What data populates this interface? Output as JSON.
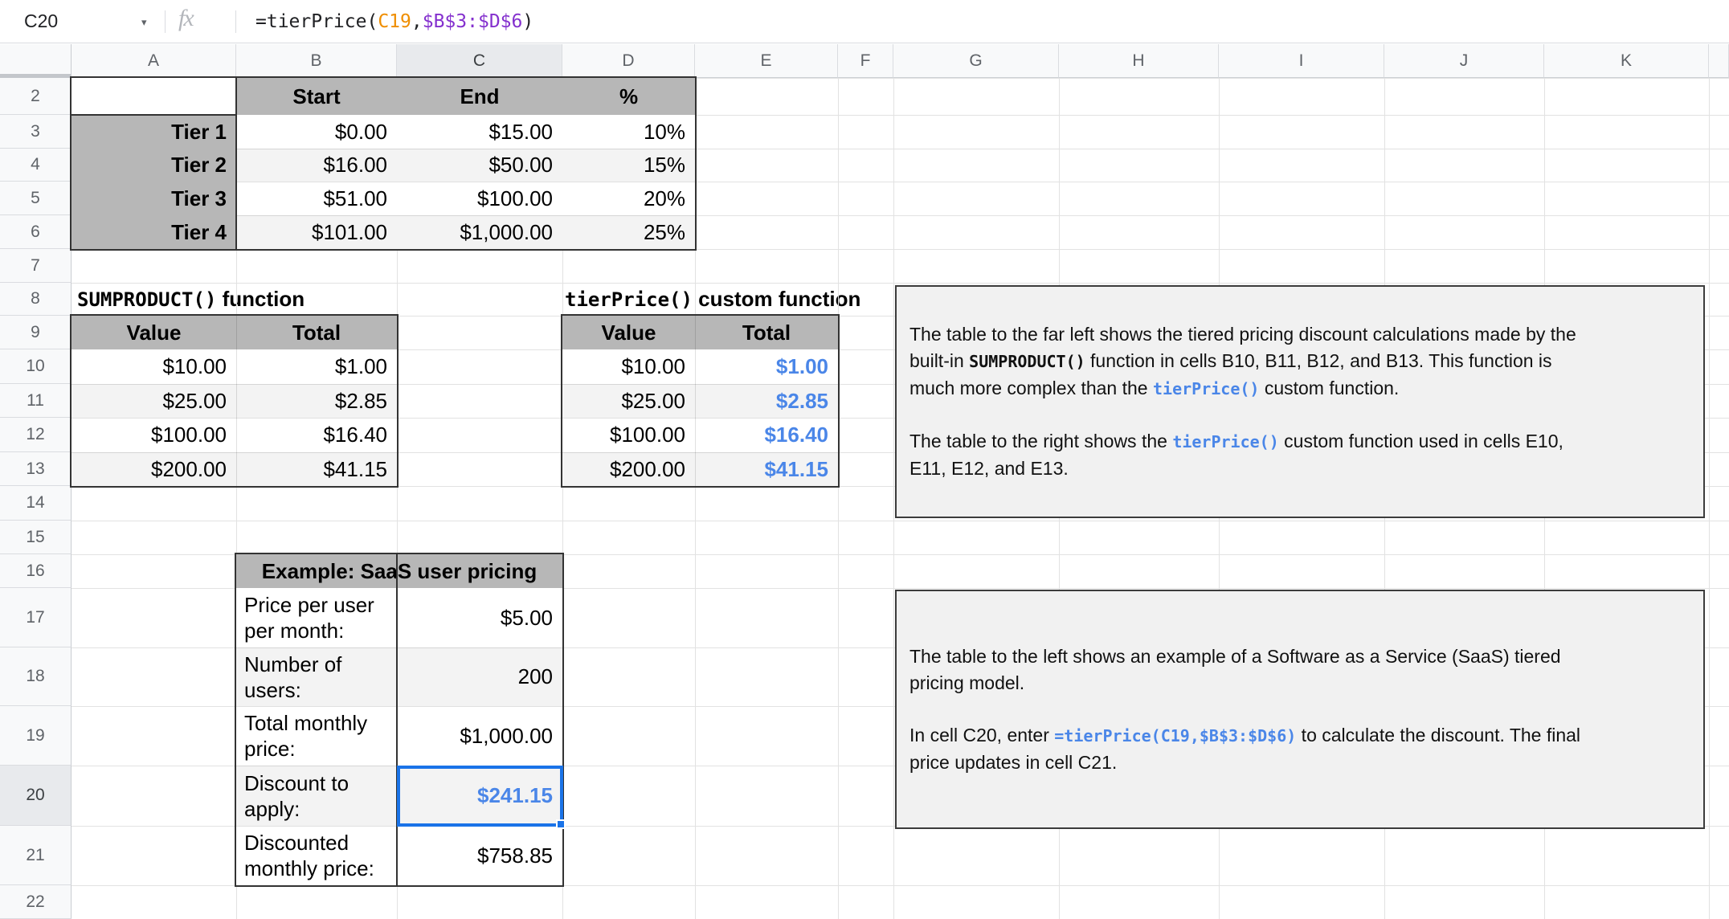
{
  "formula_bar": {
    "cell_ref": "C20",
    "fx_label": "fx",
    "formula_segments": [
      {
        "text": "=tierPrice(",
        "color": "default"
      },
      {
        "text": "C19",
        "color": "orange"
      },
      {
        "text": ",",
        "color": "default"
      },
      {
        "text": "$B$3:$D$6",
        "color": "purple"
      },
      {
        "text": ")",
        "color": "default"
      }
    ]
  },
  "colors": {
    "reference_orange": "#EF8E00",
    "reference_purple": "#8430CE",
    "accent_blue_text": "#4A86E8",
    "selection_blue": "#1A73E8",
    "table_header_gray": "#B7B7B7",
    "alt_row_gray": "#F3F3F3",
    "note_box_bg": "#F1F1F1"
  },
  "column_headers": [
    "A",
    "B",
    "C",
    "D",
    "E",
    "F",
    "G",
    "H",
    "I",
    "J",
    "K",
    ""
  ],
  "row_numbers": [
    "2",
    "3",
    "4",
    "5",
    "6",
    "7",
    "8",
    "9",
    "10",
    "11",
    "12",
    "13",
    "14",
    "15",
    "16",
    "17",
    "18",
    "19",
    "20",
    "21",
    "22"
  ],
  "selection": {
    "cell": "C20",
    "column": "C",
    "row": "20",
    "value": "$241.15"
  },
  "tier_table": {
    "col_headers": [
      "Start",
      "End",
      "%"
    ],
    "rows": [
      {
        "label": "Tier 1",
        "start": "$0.00",
        "end": "$15.00",
        "pct": "10%"
      },
      {
        "label": "Tier 2",
        "start": "$16.00",
        "end": "$50.00",
        "pct": "15%"
      },
      {
        "label": "Tier 3",
        "start": "$51.00",
        "end": "$100.00",
        "pct": "20%"
      },
      {
        "label": "Tier 4",
        "start": "$101.00",
        "end": "$1,000.00",
        "pct": "25%"
      }
    ]
  },
  "sumproduct_table": {
    "title_code": "SUMPRODUCT()",
    "title_rest": " function",
    "col_headers": [
      "Value",
      "Total"
    ],
    "rows": [
      {
        "value": "$10.00",
        "total": "$1.00"
      },
      {
        "value": "$25.00",
        "total": "$2.85"
      },
      {
        "value": "$100.00",
        "total": "$16.40"
      },
      {
        "value": "$200.00",
        "total": "$41.15"
      }
    ]
  },
  "tierprice_table": {
    "title_code": "tierPrice()",
    "title_rest": " custom function",
    "col_headers": [
      "Value",
      "Total"
    ],
    "rows": [
      {
        "value": "$10.00",
        "total": "$1.00"
      },
      {
        "value": "$25.00",
        "total": "$2.85"
      },
      {
        "value": "$100.00",
        "total": "$16.40"
      },
      {
        "value": "$200.00",
        "total": "$41.15"
      }
    ]
  },
  "saas_table": {
    "title": "Example: SaaS user pricing",
    "rows": [
      {
        "label": "Price per user per month:",
        "value": "$5.00",
        "selected": false
      },
      {
        "label": "Number of users:",
        "value": "200",
        "selected": false
      },
      {
        "label": "Total monthly price:",
        "value": "$1,000.00",
        "selected": false
      },
      {
        "label": "Discount to apply:",
        "value": "$241.15",
        "selected": true
      },
      {
        "label": "Discounted monthly price:",
        "value": "$758.85",
        "selected": false
      }
    ]
  },
  "note_box_1": {
    "paragraphs": [
      [
        {
          "text": "The table to the far left shows the tiered pricing discount calculations made by the"
        },
        {
          "break": true
        },
        {
          "text": "built-in "
        },
        {
          "text": "SUMPRODUCT()",
          "style": "code"
        },
        {
          "text": " function in cells B10, B11, B12, and B13. This function is"
        },
        {
          "break": true
        },
        {
          "text": "much more complex than the "
        },
        {
          "text": "tierPrice()",
          "style": "code-blue"
        },
        {
          "text": " custom function."
        }
      ],
      [
        {
          "text": "The table to the right shows the "
        },
        {
          "text": "tierPrice()",
          "style": "code-blue"
        },
        {
          "text": " custom function used in cells E10,"
        },
        {
          "break": true
        },
        {
          "text": "E11, E12, and E13."
        }
      ]
    ]
  },
  "note_box_2": {
    "paragraphs": [
      [
        {
          "text": "The table to the left shows an example of a Software as a Service (SaaS) tiered"
        },
        {
          "break": true
        },
        {
          "text": "pricing model."
        }
      ],
      [
        {
          "text": "In cell C20, enter "
        },
        {
          "text": "=tierPrice(C19,$B$3:$D$6)",
          "style": "code-blue"
        },
        {
          "text": " to calculate the discount. The final"
        },
        {
          "break": true
        },
        {
          "text": "price updates in cell C21."
        }
      ]
    ]
  }
}
